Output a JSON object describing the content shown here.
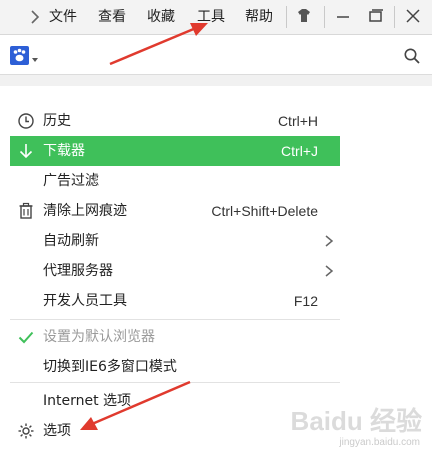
{
  "menubar": {
    "items": [
      "文件",
      "查看",
      "收藏",
      "工具",
      "帮助"
    ]
  },
  "address": {
    "search_icon": "search-icon",
    "engine_icon": "baidu-paw-icon"
  },
  "dropdown": {
    "items": [
      {
        "label": "历史",
        "shortcut": "Ctrl+H",
        "icon": "clock-icon"
      },
      {
        "label": "下载器",
        "shortcut": "Ctrl+J",
        "icon": "download-arrow-icon",
        "highlighted": true
      },
      {
        "label": "广告过滤",
        "shortcut": ""
      },
      {
        "label": "清除上网痕迹",
        "shortcut": "Ctrl+Shift+Delete",
        "icon": "trash-icon"
      },
      {
        "label": "自动刷新",
        "submenu": true
      },
      {
        "label": "代理服务器",
        "submenu": true
      },
      {
        "label": "开发人员工具",
        "shortcut": "F12"
      },
      {
        "label": "设置为默认浏览器",
        "disabled": true,
        "icon": "check-icon"
      },
      {
        "label": "切换到IE6多窗口模式"
      },
      {
        "label": "Internet 选项"
      },
      {
        "label": "选项",
        "icon": "gear-icon"
      }
    ]
  },
  "colors": {
    "highlight": "#3fc05a",
    "annotation": "#e03a2e"
  },
  "watermark": {
    "text": "Baidu 经验",
    "url": "jingyan.baidu.com"
  }
}
